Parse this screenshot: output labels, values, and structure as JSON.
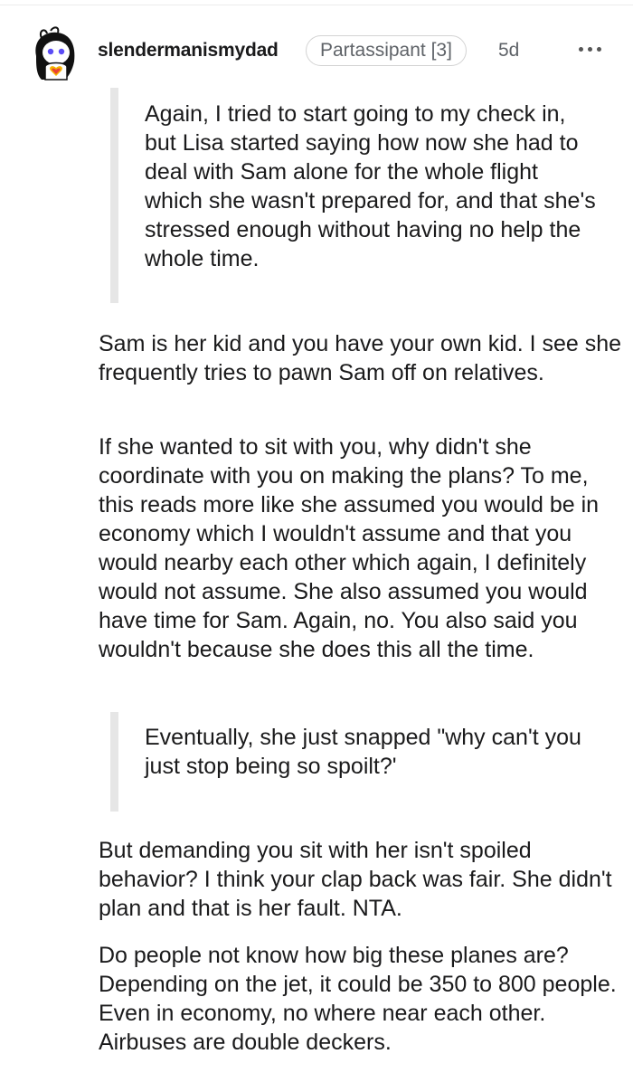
{
  "comment": {
    "username": "slendermanismydad",
    "flair": "Partassipant [3]",
    "timestamp": "5d",
    "more_icon": "more-horizontal-icon",
    "avatar_icon": "user-avatar-icon"
  },
  "body": {
    "quote_1": "Again, I tried to start going to my check in, but Lisa started saying how now she had to deal with Sam alone for the whole flight which she wasn't prepared for, and that she's stressed enough without having no help the whole time.",
    "para_1": "Sam is her kid and you have your own kid. I see she frequently tries to pawn Sam off on relatives.",
    "para_2": "If she wanted to sit with you, why didn't she coordinate with you on making the plans? To me, this reads more like she assumed you would be in economy which I wouldn't assume and that you would nearby each other which again, I definitely would not assume. She also assumed you would have time for Sam. Again, no. You also said you wouldn't because she does this all the time.",
    "quote_2": "Eventually, she just snapped \"why can't you just stop being so spoilt?'",
    "para_3": "But demanding you sit with her isn't spoiled behavior? I think your clap back was fair. She didn't plan and that is her fault. NTA.",
    "para_4": "Do people not know how big these planes are? Depending on the jet, it could be 350 to 800 people. Even in economy, no where near each other. Airbuses are double deckers."
  },
  "colors": {
    "text": "#1a1a1b",
    "meta": "#5f6368",
    "quote_bar": "#e6e6e6",
    "flair_border": "#d3d3d3"
  }
}
